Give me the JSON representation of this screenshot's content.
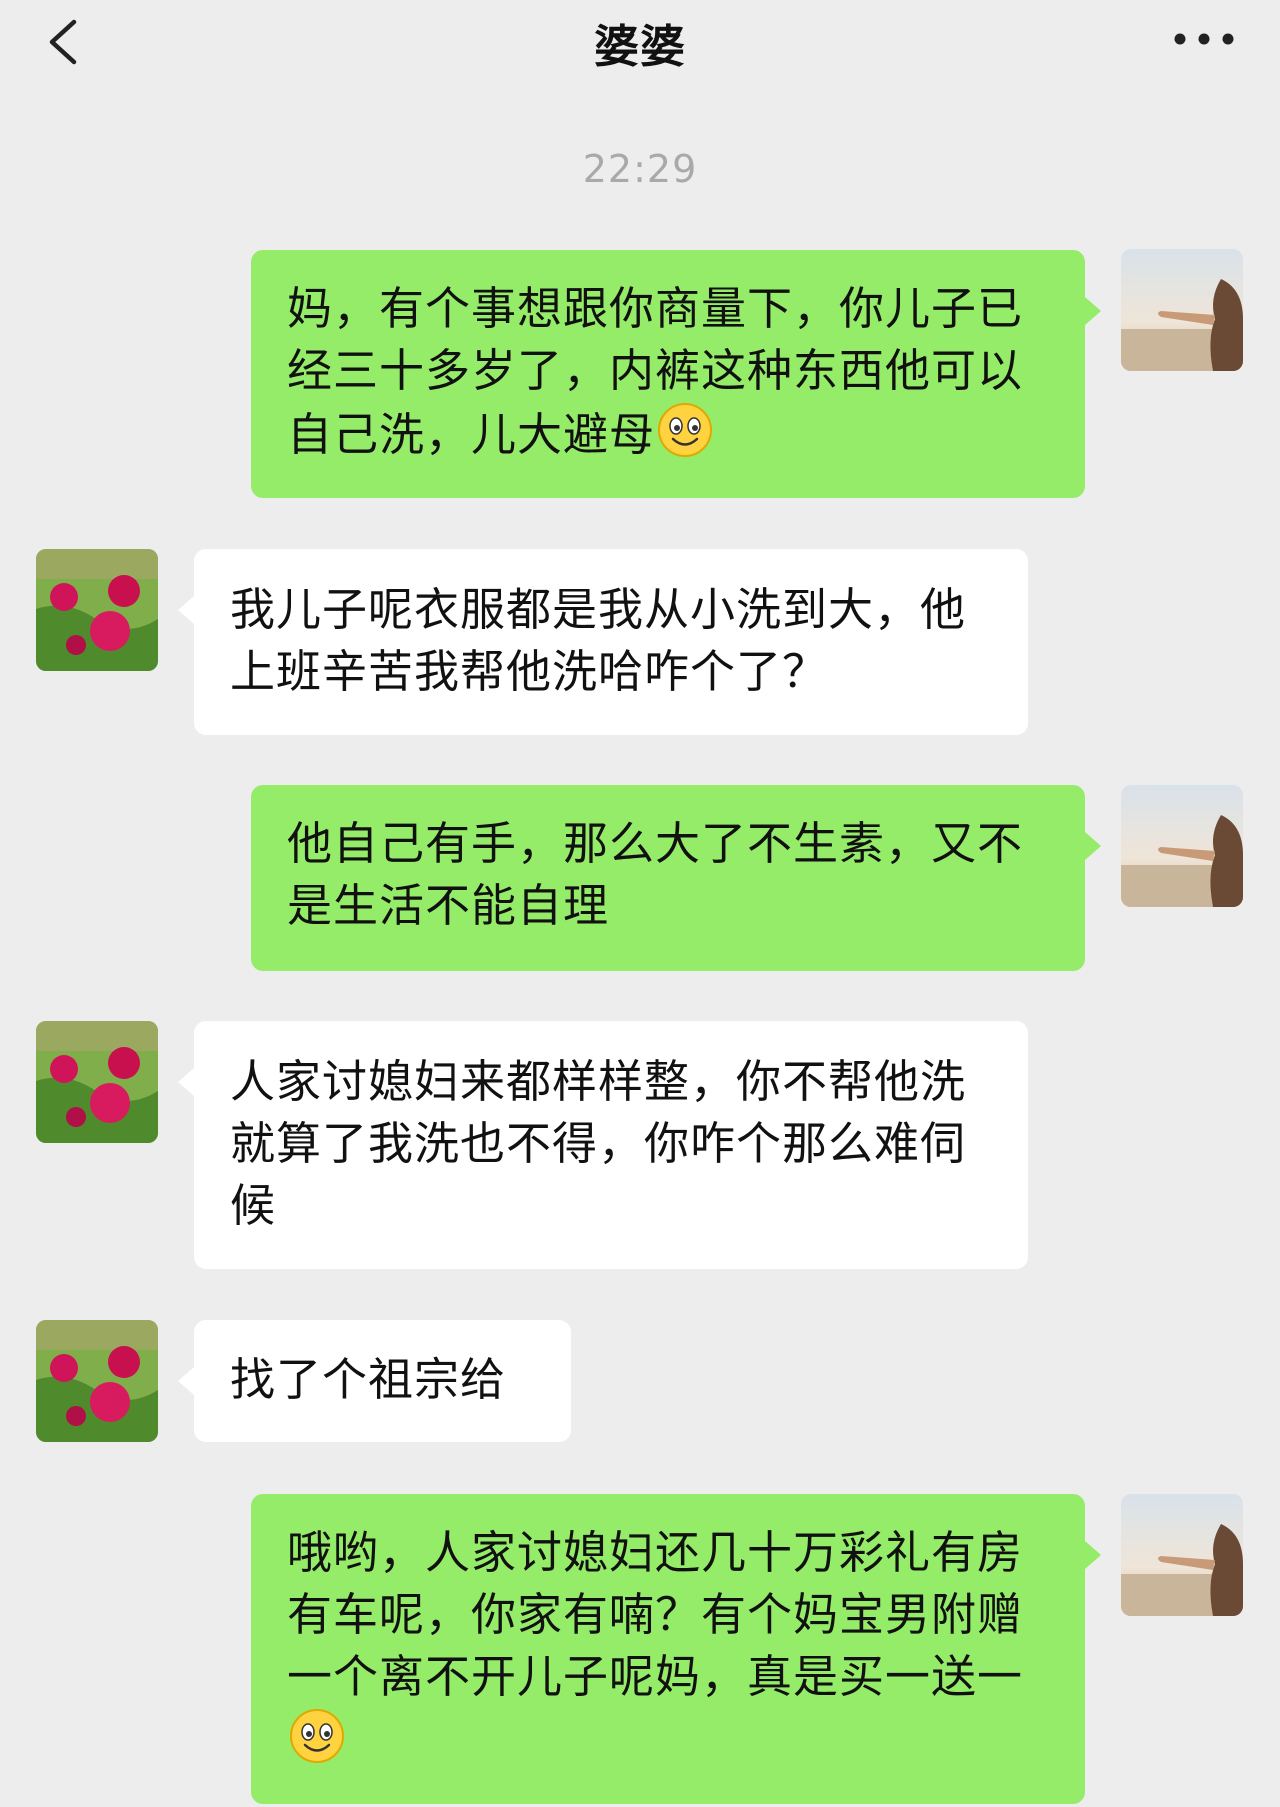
{
  "header": {
    "title": "婆婆",
    "back_icon": "chevron-left-icon",
    "more_icon": "more-horizontal-icon"
  },
  "timestamp": "22:29",
  "colors": {
    "background": "#ededed",
    "sent_bubble": "#95ec69",
    "received_bubble": "#ffffff",
    "timestamp_text": "#a9a9a9"
  },
  "messages": [
    {
      "sender": "me",
      "text": "妈，有个事想跟你商量下，你儿子已经三十多岁了，内裤这种东西他可以自己洗，儿大避母",
      "emoji": "smile-emoji"
    },
    {
      "sender": "mother-in-law",
      "text": "我儿子呢衣服都是我从小洗到大，他上班辛苦我帮他洗哈咋个了？"
    },
    {
      "sender": "me",
      "text": "他自己有手，那么大了不生素，又不是生活不能自理"
    },
    {
      "sender": "mother-in-law",
      "text": "人家讨媳妇来都样样整，你不帮他洗就算了我洗也不得，你咋个那么难伺候"
    },
    {
      "sender": "mother-in-law",
      "text": "找了个祖宗给"
    },
    {
      "sender": "me",
      "text": "哦哟，人家讨媳妇还几十万彩礼有房有车呢，你家有喃？有个妈宝男附赠一个离不开儿子呢妈，真是买一送一",
      "emoji": "smile-emoji"
    }
  ]
}
